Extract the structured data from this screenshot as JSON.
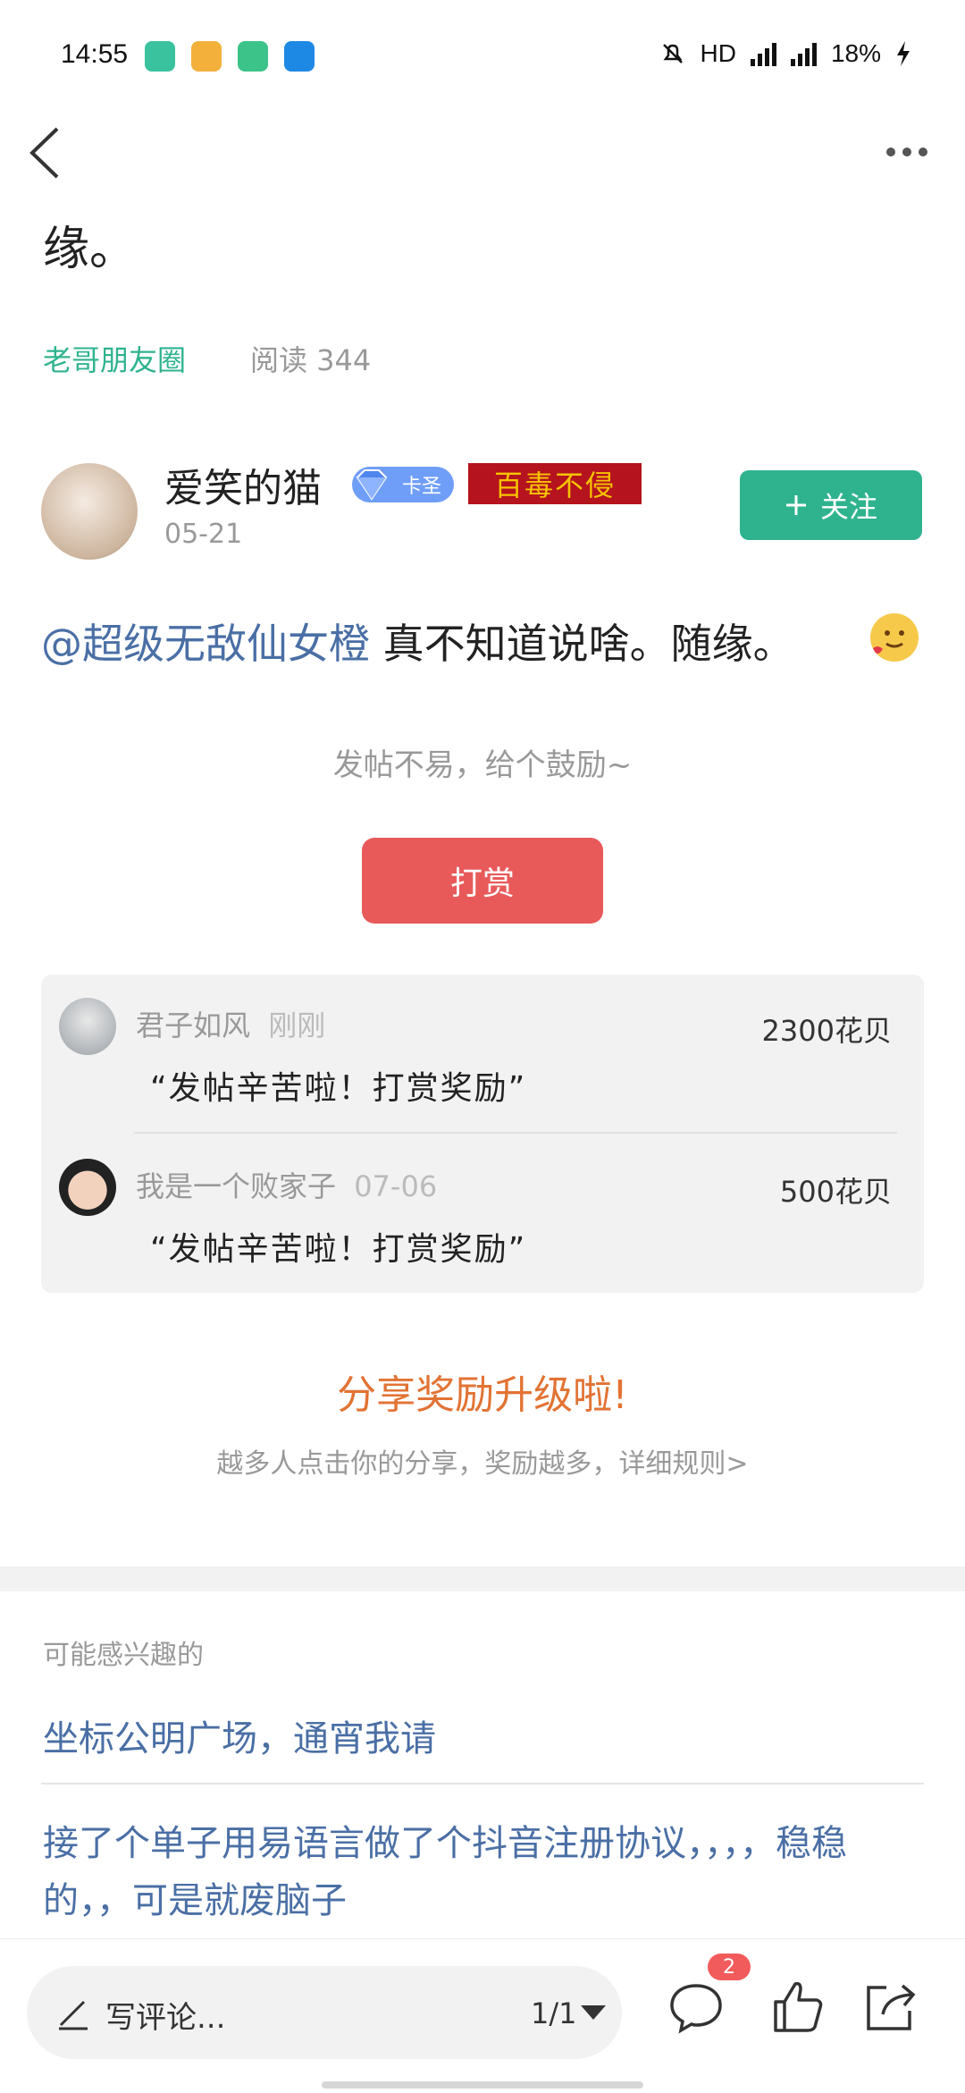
{
  "status_bar": {
    "time": "14:55",
    "network": "HD",
    "battery": "18%"
  },
  "article": {
    "title_fragment": "缘。",
    "category": "老哥朋友圈",
    "reads": "阅读 344"
  },
  "author": {
    "name": "爱笑的猫",
    "badge": "卡圣",
    "title": "百毒不侵",
    "date": "05-21",
    "follow_label": "关注"
  },
  "post": {
    "mention": "@超级无敌仙女橙",
    "text": " 真不知道说啥。随缘。"
  },
  "tip": {
    "encourage": "发帖不易，给个鼓励~",
    "button": "打赏",
    "records": [
      {
        "name": "君子如风",
        "time": "刚刚",
        "amount": "2300花贝",
        "message": "“发帖辛苦啦！打赏奖励”"
      },
      {
        "name": "我是一个败家子",
        "time": "07-06",
        "amount": "500花贝",
        "message": "“发帖辛苦啦！打赏奖励”"
      }
    ]
  },
  "share": {
    "title": "分享奖励升级啦!",
    "subtitle": "越多人点击你的分享，奖励越多，详细规则>"
  },
  "recommend": {
    "header": "可能感兴趣的",
    "items": [
      "坐标公明广场，通宵我请",
      "接了个单子用易语言做了个抖音注册协议，，，，稳稳的，，可是就废脑子"
    ]
  },
  "bottom": {
    "comment_placeholder": "写评论...",
    "page": "1/1",
    "comment_count": "2"
  },
  "colors": {
    "accent_green": "#2fb38f",
    "tip_red": "#e85a5a",
    "link_blue": "#4a6fa5",
    "share_orange": "#e27334"
  }
}
